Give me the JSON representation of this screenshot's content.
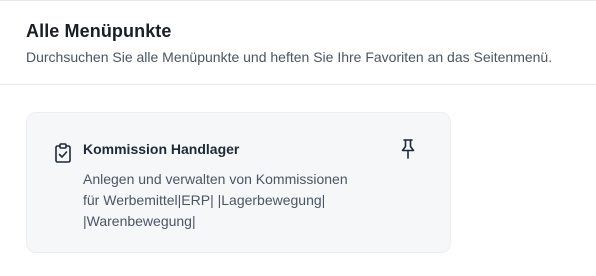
{
  "header": {
    "title": "Alle Menüpunkte",
    "subtitle": "Durchsuchen Sie alle Menüpunkte und heften Sie Ihre Favoriten an das Seitenmenü."
  },
  "cards": [
    {
      "icon": "clipboard-check-icon",
      "title": "Kommission Handlager",
      "description_lines": [
        "Anlegen und verwalten von Kommissionen",
        "für Werbemittel|ERP| |Lagerbewegung|",
        "|Warenbewegung|"
      ],
      "pin_icon": "pin-icon"
    }
  ]
}
